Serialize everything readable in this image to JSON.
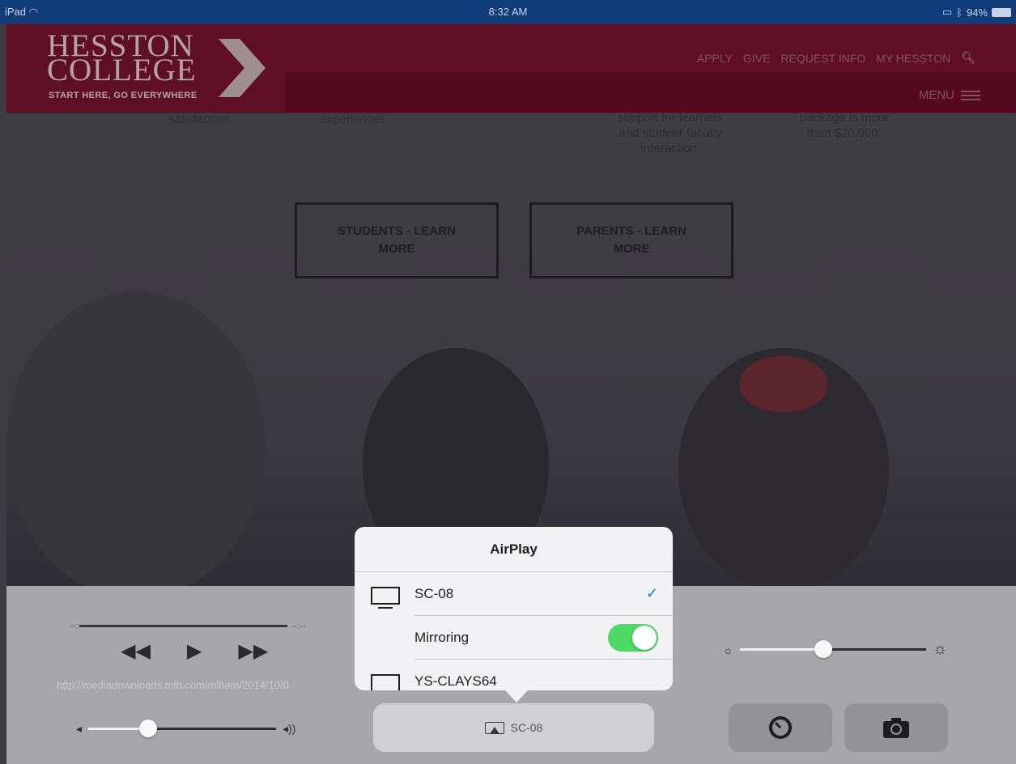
{
  "status_bar": {
    "device": "iPad",
    "time": "8:32 AM",
    "battery": "94%"
  },
  "header": {
    "logo_line1": "HESSTON",
    "logo_line2": "COLLEGE",
    "tagline": "START HERE, GO EVERYWHERE",
    "nav": [
      "APPLY",
      "GIVE",
      "REQUEST INFO",
      "MY HESSTON"
    ],
    "menu_label": "MENU"
  },
  "page": {
    "stats": [
      {
        "text": "satisfaction."
      },
      {
        "text": "experiences."
      },
      {
        "line1": "support for learners",
        "line2": "and student-faculty",
        "line3": "interaction."
      },
      {
        "line1": "package is more",
        "line2": "than $20,000."
      }
    ],
    "cta": [
      {
        "line1": "STUDENTS - LEARN",
        "line2": "MORE"
      },
      {
        "line1": "PARENTS - LEARN",
        "line2": "MORE"
      }
    ]
  },
  "control_center": {
    "elapsed": "--:--",
    "remaining": "--:--",
    "url": "http://mediadownloads.mlb.com/mlbam/2014/10/0",
    "volume_fraction": 0.32,
    "brightness_fraction": 0.45,
    "airplay_target": "SC-08"
  },
  "airplay_popover": {
    "title": "AirPlay",
    "devices": [
      {
        "name": "SC-08",
        "selected": true
      },
      {
        "name": "YS-CLAYS64",
        "selected": false
      }
    ],
    "mirroring_label": "Mirroring",
    "mirroring_on": true
  },
  "colors": {
    "status_bar": "#0e3d79",
    "header": "#5e0f25",
    "toggle_on": "#4cd964",
    "check": "#1a73e8"
  }
}
